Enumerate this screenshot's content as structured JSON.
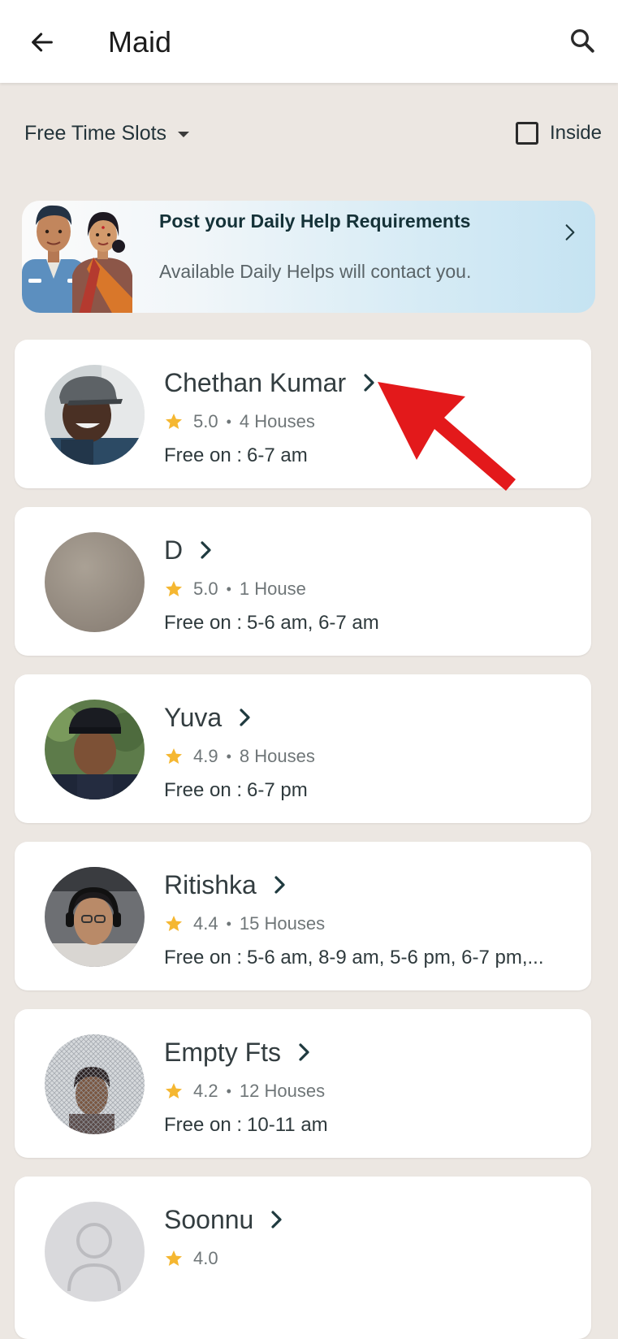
{
  "appbar": {
    "title": "Maid",
    "back_icon": "arrow-left-icon",
    "search_icon": "search-icon"
  },
  "filters": {
    "dropdown_label": "Free Time Slots",
    "checkbox_label": "Inside",
    "checkbox_checked": false
  },
  "banner": {
    "title": "Post your Daily Help Requirements",
    "subtitle": "Available Daily Helps will contact you."
  },
  "helpers": [
    {
      "name": "Chethan Kumar",
      "rating": "5.0",
      "houses": "4 Houses",
      "free_label": "Free on :",
      "free_slots": "6-7 am"
    },
    {
      "name": "D",
      "rating": "5.0",
      "houses": "1 House",
      "free_label": "Free on :",
      "free_slots": "5-6 am, 6-7 am"
    },
    {
      "name": "Yuva",
      "rating": "4.9",
      "houses": "8 Houses",
      "free_label": "Free on :",
      "free_slots": "6-7 pm"
    },
    {
      "name": "Ritishka",
      "rating": "4.4",
      "houses": "15 Houses",
      "free_label": "Free on :",
      "free_slots": "5-6 am, 8-9 am, 5-6 pm, 6-7 pm,..."
    },
    {
      "name": "Empty Fts",
      "rating": "4.2",
      "houses": "12 Houses",
      "free_label": "Free on :",
      "free_slots": "10-11 am"
    },
    {
      "name": "Soonnu",
      "rating": "4.0"
    }
  ],
  "colors": {
    "background": "#ece7e2",
    "star": "#f5b731",
    "annotation": "#e3191b",
    "chevron": "#1f3a3f"
  }
}
